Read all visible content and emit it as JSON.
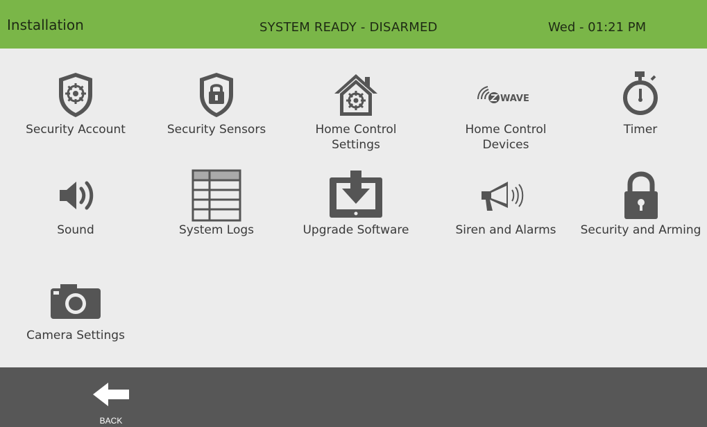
{
  "header": {
    "title": "Installation",
    "status": "SYSTEM READY - DISARMED",
    "clock": "Wed - 01:21 PM"
  },
  "tiles": [
    {
      "label": "Security Account",
      "icon": "shield-gear-icon"
    },
    {
      "label": "Security Sensors",
      "icon": "shield-lock-icon"
    },
    {
      "label": "Home Control\nSettings",
      "icon": "house-gear-icon"
    },
    {
      "label": "Home Control\nDevices",
      "icon": "zwave-icon"
    },
    {
      "label": "Timer",
      "icon": "stopwatch-icon"
    },
    {
      "label": "Sound",
      "icon": "speaker-icon"
    },
    {
      "label": "System Logs",
      "icon": "log-table-icon"
    },
    {
      "label": "Upgrade Software",
      "icon": "download-tablet-icon"
    },
    {
      "label": "Siren and Alarms",
      "icon": "megaphone-icon"
    },
    {
      "label": "Security and Arming",
      "icon": "padlock-icon"
    },
    {
      "label": "Camera Settings",
      "icon": "camera-icon"
    }
  ],
  "zwave_text": "WAVE",
  "footer": {
    "back_label": "BACK",
    "back_icon": "arrow-left-icon"
  },
  "colors": {
    "header_bg": "#7ab648",
    "body_bg": "#ececec",
    "footer_bg": "#575757",
    "icon": "#555555"
  }
}
